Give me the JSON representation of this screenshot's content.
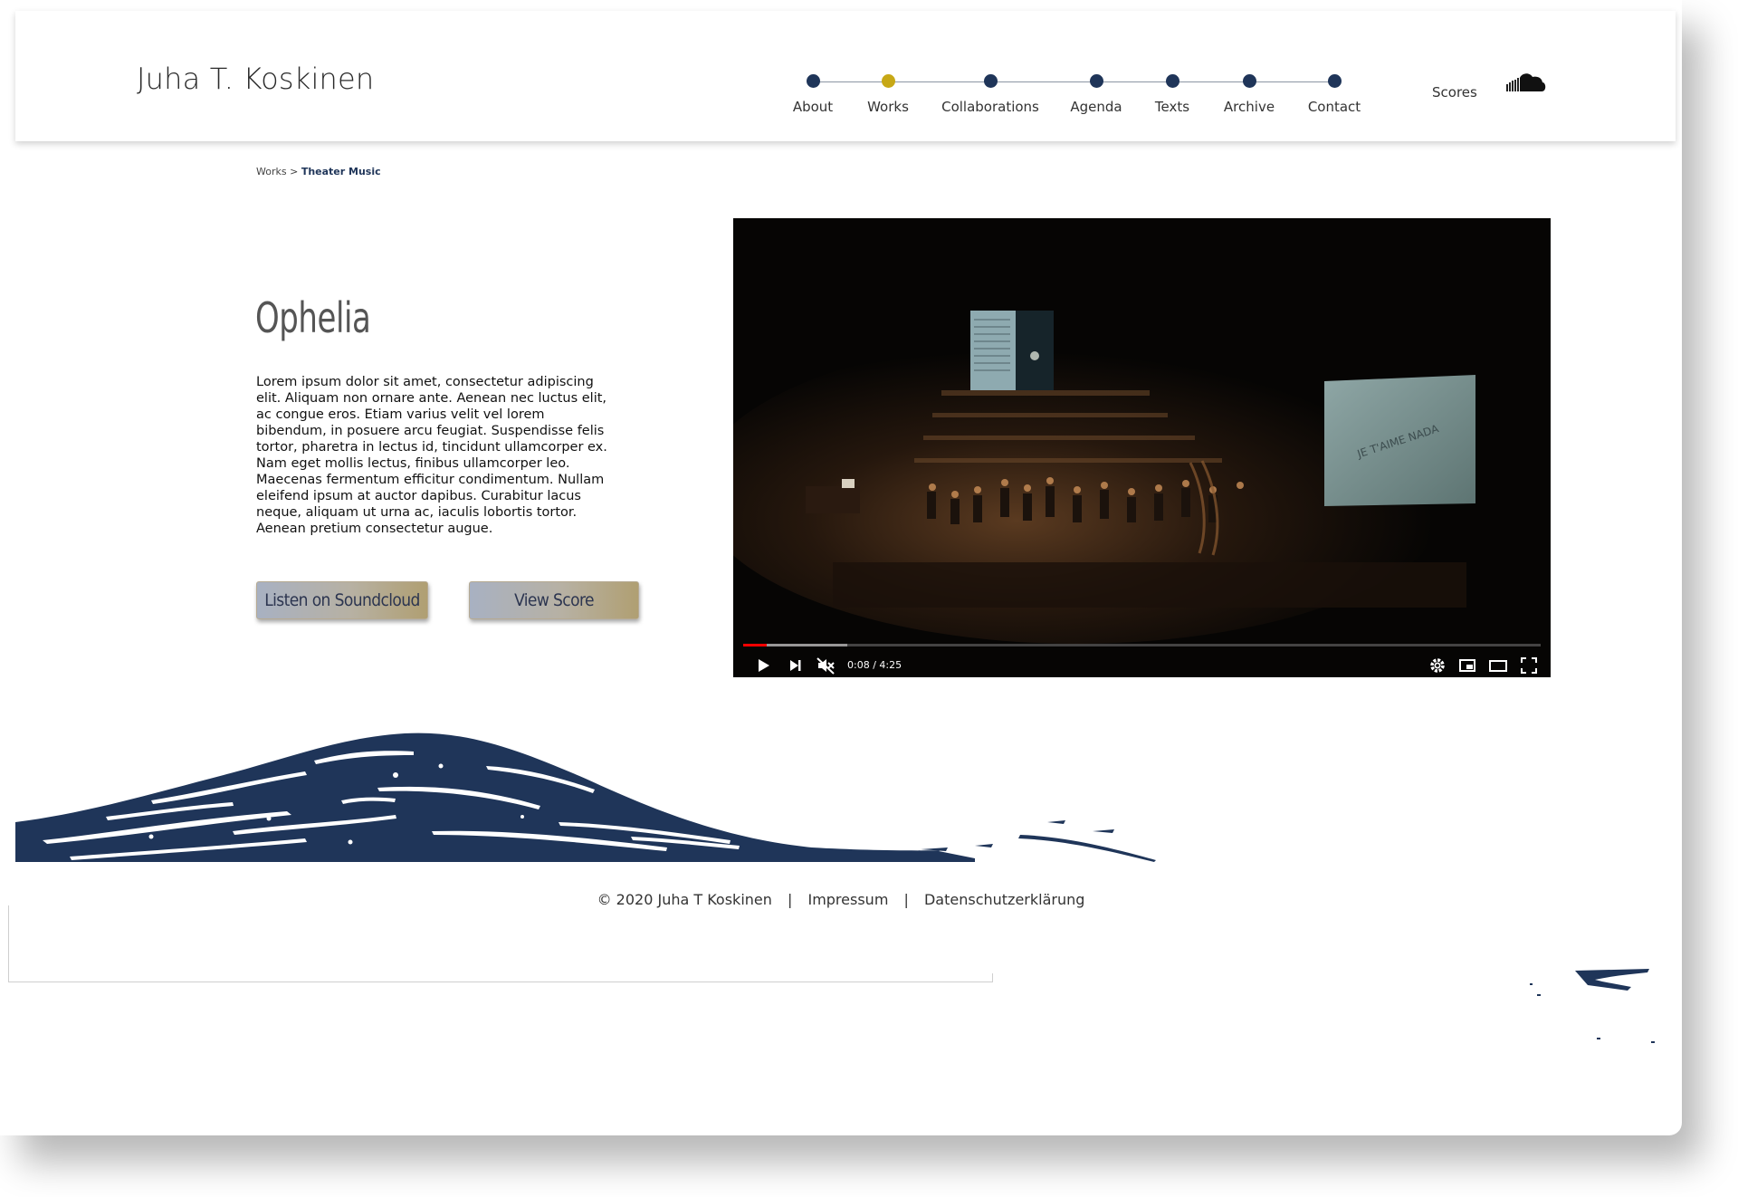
{
  "header": {
    "site_name": "Juha T. Koskinen",
    "nav": [
      {
        "label": "About",
        "active": false
      },
      {
        "label": "Works",
        "active": true
      },
      {
        "label": "Collaborations",
        "active": false
      },
      {
        "label": "Agenda",
        "active": false
      },
      {
        "label": "Texts",
        "active": false
      },
      {
        "label": "Archive",
        "active": false
      },
      {
        "label": "Contact",
        "active": false
      }
    ],
    "scores_label": "Scores",
    "soundcloud_icon": "soundcloud-icon"
  },
  "breadcrumb": {
    "parent": "Works",
    "separator": ">",
    "current": "Theater Music"
  },
  "work": {
    "title": "Ophelia",
    "description": "Lorem ipsum dolor sit amet, consectetur adipiscing elit. Aliquam non ornare ante. Aenean nec luctus elit, ac congue eros. Etiam varius velit vel lorem bibendum, in posuere arcu feugiat. Suspendisse felis tortor, pharetra in lectus id, tincidunt ullamcorper ex. Nam eget mollis lectus, finibus ullamcorper leo. Maecenas fermentum efficitur condimentum. Nullam eleifend ipsum at auctor dapibus. Curabitur lacus neque, aliquam ut urna ac, iaculis lobortis tortor. Aenean pretium consectetur augue.",
    "buttons": {
      "soundcloud": "Listen on Soundcloud",
      "score": "View Score"
    }
  },
  "video": {
    "time": "0:08 / 4:25",
    "played_fraction": 0.03,
    "buffered_fraction": 0.13,
    "screen_text": "JE T'AIME NADA",
    "colors": {
      "progress": "#ff0000",
      "background": "#060504"
    }
  },
  "footer": {
    "copyright": "© 2020  Juha T Koskinen",
    "separator": "|",
    "impressum": "Impressum",
    "privacy": "Datenschutzerklärung"
  },
  "colors": {
    "accent_navy": "#1f3559",
    "active_dot": "#c7a816"
  }
}
